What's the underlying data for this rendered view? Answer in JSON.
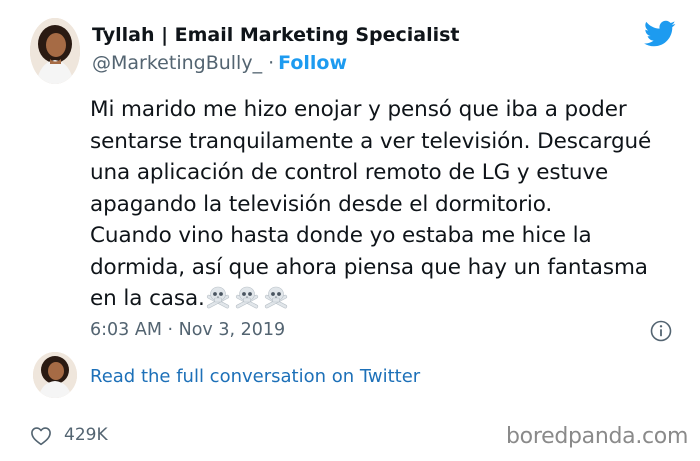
{
  "author": {
    "display_name": "Tyllah | Email Marketing Specialist",
    "handle": "@MarketingBully_",
    "separator": "·",
    "follow_label": "Follow"
  },
  "tweet": {
    "text": "Mi marido me hizo enojar y pensó que iba a poder\nsentarse tranquilamente a ver televisión. Descargué\nuna aplicación de control remoto de LG y estuve\napagando la televisión desde el dormitorio.\nCuando vino hasta donde yo estaba me hice la\ndormida, así que ahora piensa que hay un fantasma\nen la casa.",
    "emoji": [
      "skull-and-crossbones",
      "skull-and-crossbones",
      "skull-and-crossbones"
    ],
    "timestamp": "6:03 AM · Nov 3, 2019"
  },
  "conversation": {
    "link_label": "Read the full conversation on Twitter"
  },
  "engagement": {
    "likes": "429K"
  },
  "watermark": {
    "text": "boredpanda.com"
  },
  "colors": {
    "twitter_blue": "#1d9bf0",
    "text_primary": "#0f1419",
    "text_secondary": "#536471",
    "link": "#1d70b8"
  },
  "icons": {
    "brand": "twitter-bird-icon",
    "info": "info-icon",
    "like": "heart-icon"
  }
}
